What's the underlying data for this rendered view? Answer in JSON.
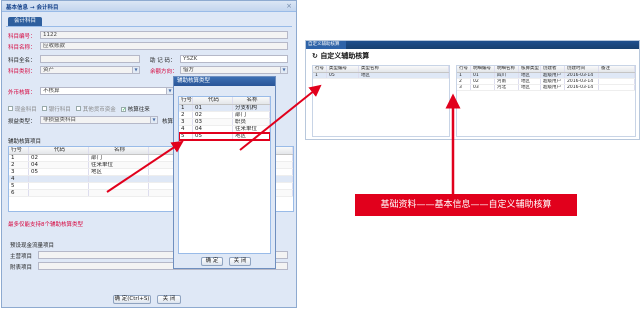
{
  "dialog": {
    "title": "基本信息 → 会计科目",
    "close": "×",
    "tab": "会计科目",
    "fields": {
      "code_label": "科目编号：",
      "code_value": "1122",
      "name_label": "科目名称：",
      "name_value": "应收账款",
      "fullname_label": "科目全名：",
      "fullname_value": "",
      "mnemonic_label": "助 记 码：",
      "mnemonic_value": "YSZK",
      "category_label": "科目类别：",
      "category_value": "资产",
      "direction_label": "余额方向：",
      "direction_value": "借方",
      "foreign_label": "外币核算：",
      "foreign_value": "不核算",
      "cash_label": "现金科目",
      "bank_label": "银行科目",
      "other_label": "其他货币资金",
      "current_label": "核算往来",
      "sub_type_label": "损益类型：",
      "sub_type_value": "非损益类科目",
      "sub_attr_label": "核算性质："
    },
    "aux_title": "辅助核算项目",
    "aux_headers": [
      "行号",
      "代码",
      "名称"
    ],
    "aux_rows": [
      {
        "no": "1",
        "code": "02",
        "name": "部门"
      },
      {
        "no": "2",
        "code": "04",
        "name": "往来单位"
      },
      {
        "no": "3",
        "code": "05",
        "name": "地区"
      },
      {
        "no": "4",
        "code": "",
        "name": ""
      },
      {
        "no": "5",
        "code": "",
        "name": ""
      },
      {
        "no": "6",
        "code": "",
        "name": ""
      }
    ],
    "aux_hint": "最多仅能支持8个辅助核算类型",
    "cashflow_title": "预设现金流量项目",
    "main_item_label": "主营项目",
    "attach_item_label": "附表项目",
    "ok_button": "确 定(Ctrl+S)",
    "close_button": "关 闭"
  },
  "popup": {
    "title": "辅助核算类型",
    "headers": [
      "行号",
      "代码",
      "名称"
    ],
    "rows": [
      {
        "no": "1",
        "code": "01",
        "name": "分支机构"
      },
      {
        "no": "2",
        "code": "02",
        "name": "部门"
      },
      {
        "no": "3",
        "code": "03",
        "name": "职员"
      },
      {
        "no": "4",
        "code": "04",
        "name": "往来单位"
      },
      {
        "no": "5",
        "code": "05",
        "name": "地区"
      }
    ],
    "ok_button": "确 定",
    "close_button": "关 闭"
  },
  "right_panel": {
    "tab_label": "自定义辅助核算",
    "heading": "自定义辅助核算",
    "left_headers": [
      "行号",
      "类型编号",
      "类型名称"
    ],
    "left_rows": [
      {
        "no": "1",
        "code": "05",
        "name": "地区"
      }
    ],
    "right_headers": [
      "行号",
      "明细编号",
      "明细名称",
      "核算类型",
      "创建者",
      "创建时间",
      "备注"
    ],
    "right_rows": [
      {
        "no": "1",
        "code": "01",
        "name": "四川",
        "type": "地区",
        "creator": "超级用户",
        "date": "2016-03-14",
        "note": ""
      },
      {
        "no": "2",
        "code": "02",
        "name": "河南",
        "type": "地区",
        "creator": "超级用户",
        "date": "2016-03-14",
        "note": ""
      },
      {
        "no": "3",
        "code": "03",
        "name": "河北",
        "type": "地区",
        "creator": "超级用户",
        "date": "2016-03-14",
        "note": ""
      }
    ]
  },
  "caption": "基础资料——基本信息——自定义辅助核算",
  "colors": {
    "annotation_red": "#e1001c",
    "header_blue": "#1e4f8e"
  }
}
